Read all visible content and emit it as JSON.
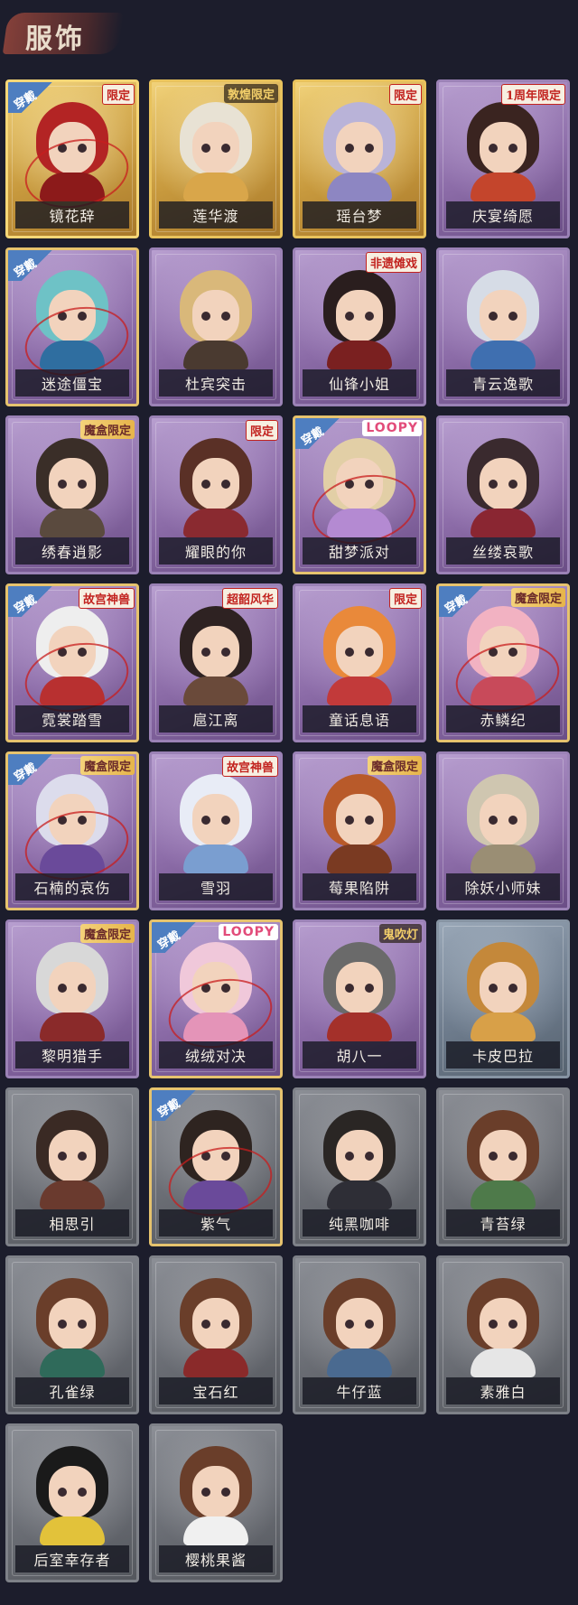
{
  "header": {
    "title": "服饰"
  },
  "badge_equipped": "穿戴",
  "items": [
    {
      "name": "镜花辞",
      "frame": "gold",
      "equipped": true,
      "tag": "限定",
      "tag_style": "red",
      "hair": "#b32424",
      "outfit": "#8c1a1a"
    },
    {
      "name": "莲华渡",
      "frame": "gold",
      "equipped": false,
      "tag": "敦煌限定",
      "tag_style": "gold",
      "hair": "#e8e2d4",
      "outfit": "#d9a64a"
    },
    {
      "name": "瑶台梦",
      "frame": "gold",
      "equipped": false,
      "tag": "限定",
      "tag_style": "red",
      "hair": "#b9b3d8",
      "outfit": "#8d86c2"
    },
    {
      "name": "庆宴绮愿",
      "frame": "purple",
      "equipped": false,
      "tag": "1周年限定",
      "tag_style": "red",
      "hair": "#3a2420",
      "outfit": "#c4452c"
    },
    {
      "name": "迷途僵宝",
      "frame": "purple",
      "equipped": true,
      "tag": "",
      "tag_style": "",
      "hair": "#6ec2c6",
      "outfit": "#2f6ea0"
    },
    {
      "name": "杜宾突击",
      "frame": "purple",
      "equipped": false,
      "tag": "",
      "tag_style": "",
      "hair": "#d9b87a",
      "outfit": "#4a3a30"
    },
    {
      "name": "仙锋小姐",
      "frame": "purple",
      "equipped": false,
      "tag": "非遗傩戏",
      "tag_style": "red",
      "hair": "#2a1e1e",
      "outfit": "#7a2020"
    },
    {
      "name": "青云逸歌",
      "frame": "purple",
      "equipped": false,
      "tag": "",
      "tag_style": "",
      "hair": "#d6dce6",
      "outfit": "#3f6fb0"
    },
    {
      "name": "绣春逍影",
      "frame": "purple",
      "equipped": false,
      "tag": "魔盒限定",
      "tag_style": "box",
      "hair": "#3a2e28",
      "outfit": "#5a4a3e"
    },
    {
      "name": "耀眼的你",
      "frame": "purple",
      "equipped": false,
      "tag": "限定",
      "tag_style": "red",
      "hair": "#5a3026",
      "outfit": "#8a2a30"
    },
    {
      "name": "甜梦派对",
      "frame": "purple",
      "equipped": true,
      "tag": "LOOPY",
      "tag_style": "loopy",
      "hair": "#e2cfa6",
      "outfit": "#b48ad2"
    },
    {
      "name": "丝缕哀歌",
      "frame": "purple",
      "equipped": false,
      "tag": "",
      "tag_style": "",
      "hair": "#3a2a2e",
      "outfit": "#8a2632"
    },
    {
      "name": "霓裳踏雪",
      "frame": "purple",
      "equipped": true,
      "tag": "故宫神兽",
      "tag_style": "red",
      "hair": "#eeeeee",
      "outfit": "#b83030"
    },
    {
      "name": "扈江离",
      "frame": "purple",
      "equipped": false,
      "tag": "超韶风华",
      "tag_style": "red",
      "hair": "#2e2222",
      "outfit": "#6a4a3a"
    },
    {
      "name": "童话息语",
      "frame": "purple",
      "equipped": false,
      "tag": "限定",
      "tag_style": "red",
      "hair": "#e9893a",
      "outfit": "#c23a3a"
    },
    {
      "name": "赤鳞纪",
      "frame": "purple",
      "equipped": true,
      "tag": "魔盒限定",
      "tag_style": "box",
      "hair": "#f2b2c2",
      "outfit": "#c84a5a"
    },
    {
      "name": "石楠的哀伤",
      "frame": "purple",
      "equipped": true,
      "tag": "魔盒限定",
      "tag_style": "box",
      "hair": "#dcdcec",
      "outfit": "#6a4a9a"
    },
    {
      "name": "雪羽",
      "frame": "purple",
      "equipped": false,
      "tag": "故宫神兽",
      "tag_style": "red",
      "hair": "#e8ecf6",
      "outfit": "#7a9ed0"
    },
    {
      "name": "莓果陷阱",
      "frame": "purple",
      "equipped": false,
      "tag": "魔盒限定",
      "tag_style": "box",
      "hair": "#b85a2a",
      "outfit": "#7a3a22"
    },
    {
      "name": "除妖小师妹",
      "frame": "purple",
      "equipped": false,
      "tag": "",
      "tag_style": "",
      "hair": "#cfc6b0",
      "outfit": "#9a8e74"
    },
    {
      "name": "黎明猎手",
      "frame": "purple",
      "equipped": false,
      "tag": "魔盒限定",
      "tag_style": "box",
      "hair": "#d8d8d8",
      "outfit": "#8a2a2a"
    },
    {
      "name": "绒绒对决",
      "frame": "purple",
      "equipped": true,
      "tag": "LOOPY",
      "tag_style": "loopy",
      "hair": "#f0c8da",
      "outfit": "#e494b8"
    },
    {
      "name": "胡八一",
      "frame": "purple",
      "equipped": false,
      "tag": "鬼吹灯",
      "tag_style": "gold",
      "hair": "#6a6a6a",
      "outfit": "#a4302a"
    },
    {
      "name": "卡皮巴拉",
      "frame": "blue",
      "equipped": false,
      "tag": "",
      "tag_style": "",
      "hair": "#c4883a",
      "outfit": "#d8a048"
    },
    {
      "name": "相思引",
      "frame": "gray",
      "equipped": false,
      "tag": "",
      "tag_style": "",
      "hair": "#3a2a24",
      "outfit": "#6a3a2e"
    },
    {
      "name": "紫气",
      "frame": "gray",
      "equipped": true,
      "tag": "",
      "tag_style": "",
      "hair": "#2e2420",
      "outfit": "#6a4a9a"
    },
    {
      "name": "纯黑咖啡",
      "frame": "gray",
      "equipped": false,
      "tag": "",
      "tag_style": "",
      "hair": "#2a2624",
      "outfit": "#2e2e36"
    },
    {
      "name": "青苔绿",
      "frame": "gray",
      "equipped": false,
      "tag": "",
      "tag_style": "",
      "hair": "#6a3e2a",
      "outfit": "#4e7a4a"
    },
    {
      "name": "孔雀绿",
      "frame": "gray",
      "equipped": false,
      "tag": "",
      "tag_style": "",
      "hair": "#6a3e2a",
      "outfit": "#2f6a5a"
    },
    {
      "name": "宝石红",
      "frame": "gray",
      "equipped": false,
      "tag": "",
      "tag_style": "",
      "hair": "#6a3e2a",
      "outfit": "#8a2a2a"
    },
    {
      "name": "牛仔蓝",
      "frame": "gray",
      "equipped": false,
      "tag": "",
      "tag_style": "",
      "hair": "#6a3e2a",
      "outfit": "#4a6a90"
    },
    {
      "name": "素雅白",
      "frame": "gray",
      "equipped": false,
      "tag": "",
      "tag_style": "",
      "hair": "#6a3e2a",
      "outfit": "#e6e6e6"
    },
    {
      "name": "后室幸存者",
      "frame": "gray",
      "equipped": false,
      "tag": "",
      "tag_style": "",
      "hair": "#1a1a1a",
      "outfit": "#e2c23a"
    },
    {
      "name": "樱桃果酱",
      "frame": "gray",
      "equipped": false,
      "tag": "",
      "tag_style": "",
      "hair": "#6a3e2a",
      "outfit": "#f0f0f0"
    }
  ]
}
